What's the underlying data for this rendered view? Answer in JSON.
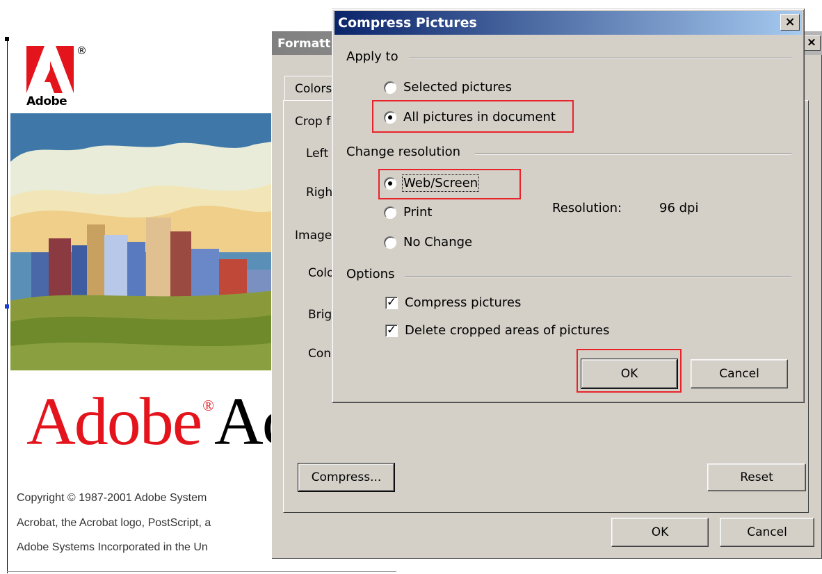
{
  "background_doc": {
    "logo_text": "Adobe",
    "brand_text": "Adobe",
    "brand_text_cut": "Ac",
    "copyright_lines": [
      "Copyright © 1987-2001 Adobe System",
      "Acrobat, the Acrobat logo, PostScript, a",
      "Adobe Systems Incorporated in the Un"
    ]
  },
  "format_dialog": {
    "title": "Formatt",
    "tab_label": "Colors",
    "labels": [
      "Crop f",
      "Left",
      "Right",
      "Image",
      "Colo",
      "Brig",
      "Con"
    ],
    "compress_button": "Compress...",
    "reset_button": "Reset",
    "ok_button": "OK",
    "cancel_button": "Cancel"
  },
  "compress_dialog": {
    "title": "Compress Pictures",
    "close_glyph": "×",
    "apply_to": {
      "heading": "Apply to",
      "options": [
        {
          "label": "Selected pictures",
          "selected": false
        },
        {
          "label": "All pictures in document",
          "selected": true
        }
      ]
    },
    "change_resolution": {
      "heading": "Change resolution",
      "options": [
        {
          "label": "Web/Screen",
          "selected": true
        },
        {
          "label": "Print",
          "selected": false
        },
        {
          "label": "No Change",
          "selected": false
        }
      ],
      "resolution_label": "Resolution:",
      "resolution_value": "96 dpi"
    },
    "options": {
      "heading": "Options",
      "items": [
        {
          "label": "Compress pictures",
          "checked": true
        },
        {
          "label": "Delete cropped areas of pictures",
          "checked": true
        }
      ]
    },
    "ok_button": "OK",
    "cancel_button": "Cancel"
  },
  "colors": {
    "dialog_bg": "#d4d0c8",
    "active_title_start": "#0a246a",
    "active_title_end": "#a6caf0",
    "highlight": "#e8232a",
    "adobe_red": "#e4141c"
  },
  "icons": [
    "adobe-logo-icon",
    "close-icon",
    "radio-icon",
    "checkbox-icon"
  ]
}
